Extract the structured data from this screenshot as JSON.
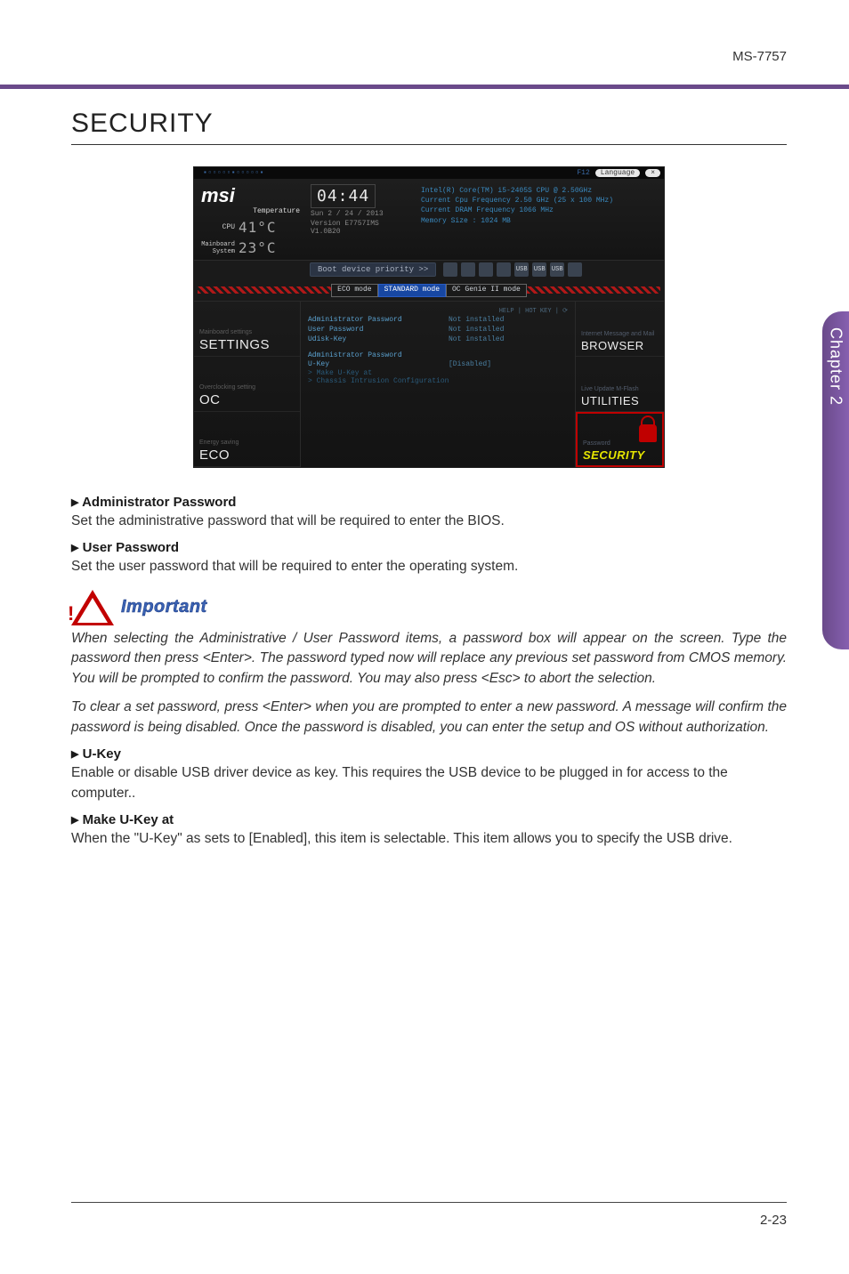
{
  "header": {
    "model": "MS-7757"
  },
  "sideTab": "Chapter 2",
  "pageTitle": "SECURITY",
  "bios": {
    "titlebar": {
      "dots": "▪▫▫▫▫▫▪▫▫▫▫▫▪",
      "f12": "F12",
      "lang": "Language",
      "close": "×"
    },
    "brand": "msi",
    "tempLabel": "Temperature",
    "cpuLabel": "CPU",
    "cpuTemp": "41°C",
    "sysLabel": "Mainboard System",
    "sysTemp": "23°C",
    "clock": "04:44",
    "date": "Sun  2 / 24 / 2013",
    "ver": "Version E7757IMS V1.0B20",
    "info1": "Intel(R) Core(TM) i5-2405S CPU @ 2.50GHz",
    "info2": "Current Cpu Frequency 2.50 GHz (25 x 100 MHz)",
    "info3": "Current DRAM Frequency 1066 MHz",
    "info4": "Memory Size : 1024 MB",
    "bootLabel": "Boot device priority  >>",
    "modes": {
      "eco": "ECO mode",
      "std": "STANDARD mode",
      "ocg": "OC Genie II mode"
    },
    "help": "HELP | HOT KEY | ⟳",
    "rows": [
      {
        "lbl": "Administrator Password",
        "val": "Not installed"
      },
      {
        "lbl": "User Password",
        "val": "Not installed"
      },
      {
        "lbl": "Udisk-Key",
        "val": "Not installed"
      }
    ],
    "section": "Administrator Password",
    "ukeyRow": {
      "lbl": "U-Key",
      "val": "[Disabled]"
    },
    "makeUkey": "> Make U-Key at",
    "chassis": "> Chassis Intrusion Configuration",
    "leftTiles": [
      {
        "sub": "Mainboard settings",
        "main": "SETTINGS"
      },
      {
        "sub": "Overclocking setting",
        "main": "OC"
      },
      {
        "sub": "Energy saving",
        "main": "ECO"
      }
    ],
    "rightTiles": [
      {
        "sub": "Internet Message and Mail",
        "main": "BROWSER"
      },
      {
        "sub": "Live Update M-Flash",
        "main": "UTILITIES"
      },
      {
        "sub": "Password",
        "main": "SECURITY"
      }
    ]
  },
  "items": {
    "adminH": "Administrator Password",
    "adminP": "Set the administrative password that will be required to enter the BIOS.",
    "userH": "User Password",
    "userP": "Set the user password that will be required to enter the operating system.",
    "importantLabel": "Important",
    "imp1": "When selecting the Administrative / User Password items, a password box will appear on the screen. Type the password then press <Enter>. The password typed now will replace any previous set password from CMOS memory. You will be prompted to confirm the password. You may also press <Esc> to abort the selection.",
    "imp2": "To clear a set password, press <Enter> when you are prompted to enter a new password. A message will confirm the password is being disabled. Once the password is disabled, you can enter the setup and OS without authorization.",
    "ukeyH": "U-Key",
    "ukeyP": "Enable or disable USB driver device as key. This requires the USB device to be plugged in for access to the computer..",
    "makeH": "Make U-Key at",
    "makeP": "When the \"U-Key\" as sets to [Enabled], this item is selectable. This item allows you to specify the USB drive."
  },
  "footer": {
    "page": "2-23"
  }
}
